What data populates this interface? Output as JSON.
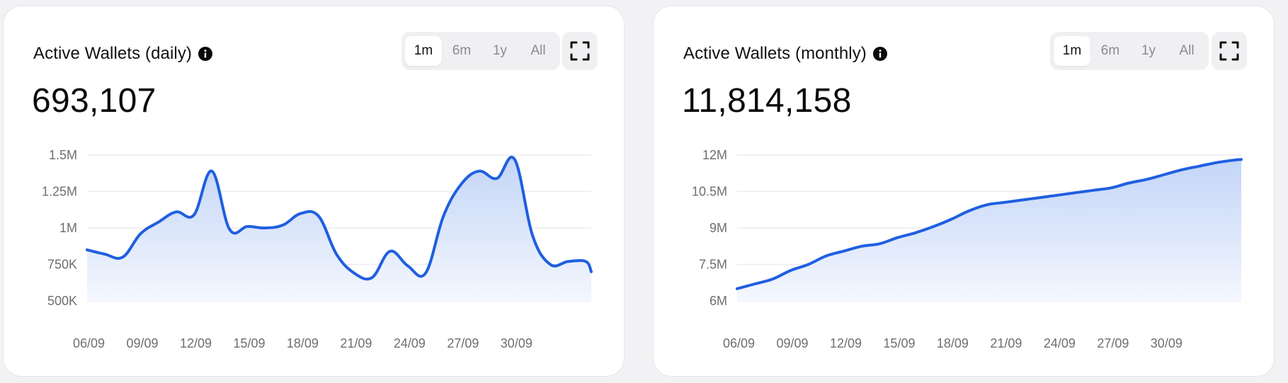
{
  "cards": [
    {
      "title": "Active Wallets (daily)",
      "value": "693,107",
      "ranges": [
        "1m",
        "6m",
        "1y",
        "All"
      ],
      "active_range": "1m"
    },
    {
      "title": "Active Wallets (monthly)",
      "value": "11,814,158",
      "ranges": [
        "1m",
        "6m",
        "1y",
        "All"
      ],
      "active_range": "1m"
    }
  ],
  "colors": {
    "line": "#1f5fe0",
    "fill_top": "#c3d5f7",
    "fill_bottom": "#f4f7fe",
    "grid": "#ececee"
  },
  "chart_data": [
    {
      "type": "area",
      "title": "Active Wallets (daily)",
      "xlabel": "",
      "ylabel": "",
      "ylim": [
        500000,
        1500000
      ],
      "grid": true,
      "y_ticks": [
        500000,
        750000,
        1000000,
        1250000,
        1500000
      ],
      "y_tick_labels": [
        "500K",
        "750K",
        "1M",
        "1.25M",
        "1.5M"
      ],
      "x_tick_labels": [
        "06/09",
        "09/09",
        "12/09",
        "15/09",
        "18/09",
        "21/09",
        "24/09",
        "27/09",
        "30/09"
      ],
      "x_tick_positions": [
        6,
        9,
        12,
        15,
        18,
        21,
        24,
        27,
        30
      ],
      "x_range": [
        5.9,
        34.2
      ],
      "x": [
        5.9,
        6.9,
        7.9,
        8.9,
        9.9,
        10.9,
        11.9,
        12.9,
        13.9,
        14.9,
        15.9,
        16.9,
        17.9,
        18.9,
        19.9,
        20.9,
        21.9,
        22.9,
        23.9,
        24.9,
        25.9,
        26.9,
        27.9,
        28.9,
        29.9,
        30.9,
        31.9,
        32.9,
        33.9,
        34.2
      ],
      "values": [
        850000,
        820000,
        800000,
        960000,
        1040000,
        1110000,
        1090000,
        1390000,
        990000,
        1010000,
        1000000,
        1020000,
        1100000,
        1080000,
        820000,
        690000,
        660000,
        840000,
        740000,
        690000,
        1080000,
        1300000,
        1390000,
        1340000,
        1470000,
        950000,
        750000,
        770000,
        770000,
        700000
      ]
    },
    {
      "type": "area",
      "title": "Active Wallets (monthly)",
      "xlabel": "",
      "ylabel": "",
      "ylim": [
        6000000,
        12000000
      ],
      "grid": true,
      "y_ticks": [
        6000000,
        7500000,
        9000000,
        10500000,
        12000000
      ],
      "y_tick_labels": [
        "6M",
        "7.5M",
        "9M",
        "10.5M",
        "12M"
      ],
      "x_tick_labels": [
        "06/09",
        "09/09",
        "12/09",
        "15/09",
        "18/09",
        "21/09",
        "24/09",
        "27/09",
        "30/09"
      ],
      "x_tick_positions": [
        6,
        9,
        12,
        15,
        18,
        21,
        24,
        27,
        30
      ],
      "x_range": [
        5.9,
        34.2
      ],
      "x": [
        5.9,
        6.9,
        7.9,
        8.9,
        9.9,
        10.9,
        11.9,
        12.9,
        13.9,
        14.9,
        15.9,
        16.9,
        17.9,
        18.9,
        19.9,
        20.9,
        21.9,
        22.9,
        23.9,
        24.9,
        25.9,
        26.9,
        27.9,
        28.9,
        29.9,
        30.9,
        31.9,
        32.9,
        33.9,
        34.2
      ],
      "values": [
        6500000,
        6700000,
        6900000,
        7250000,
        7500000,
        7850000,
        8050000,
        8250000,
        8350000,
        8600000,
        8800000,
        9050000,
        9350000,
        9700000,
        9950000,
        10050000,
        10150000,
        10250000,
        10350000,
        10450000,
        10550000,
        10650000,
        10850000,
        11000000,
        11200000,
        11400000,
        11550000,
        11700000,
        11800000,
        11820000
      ]
    }
  ]
}
